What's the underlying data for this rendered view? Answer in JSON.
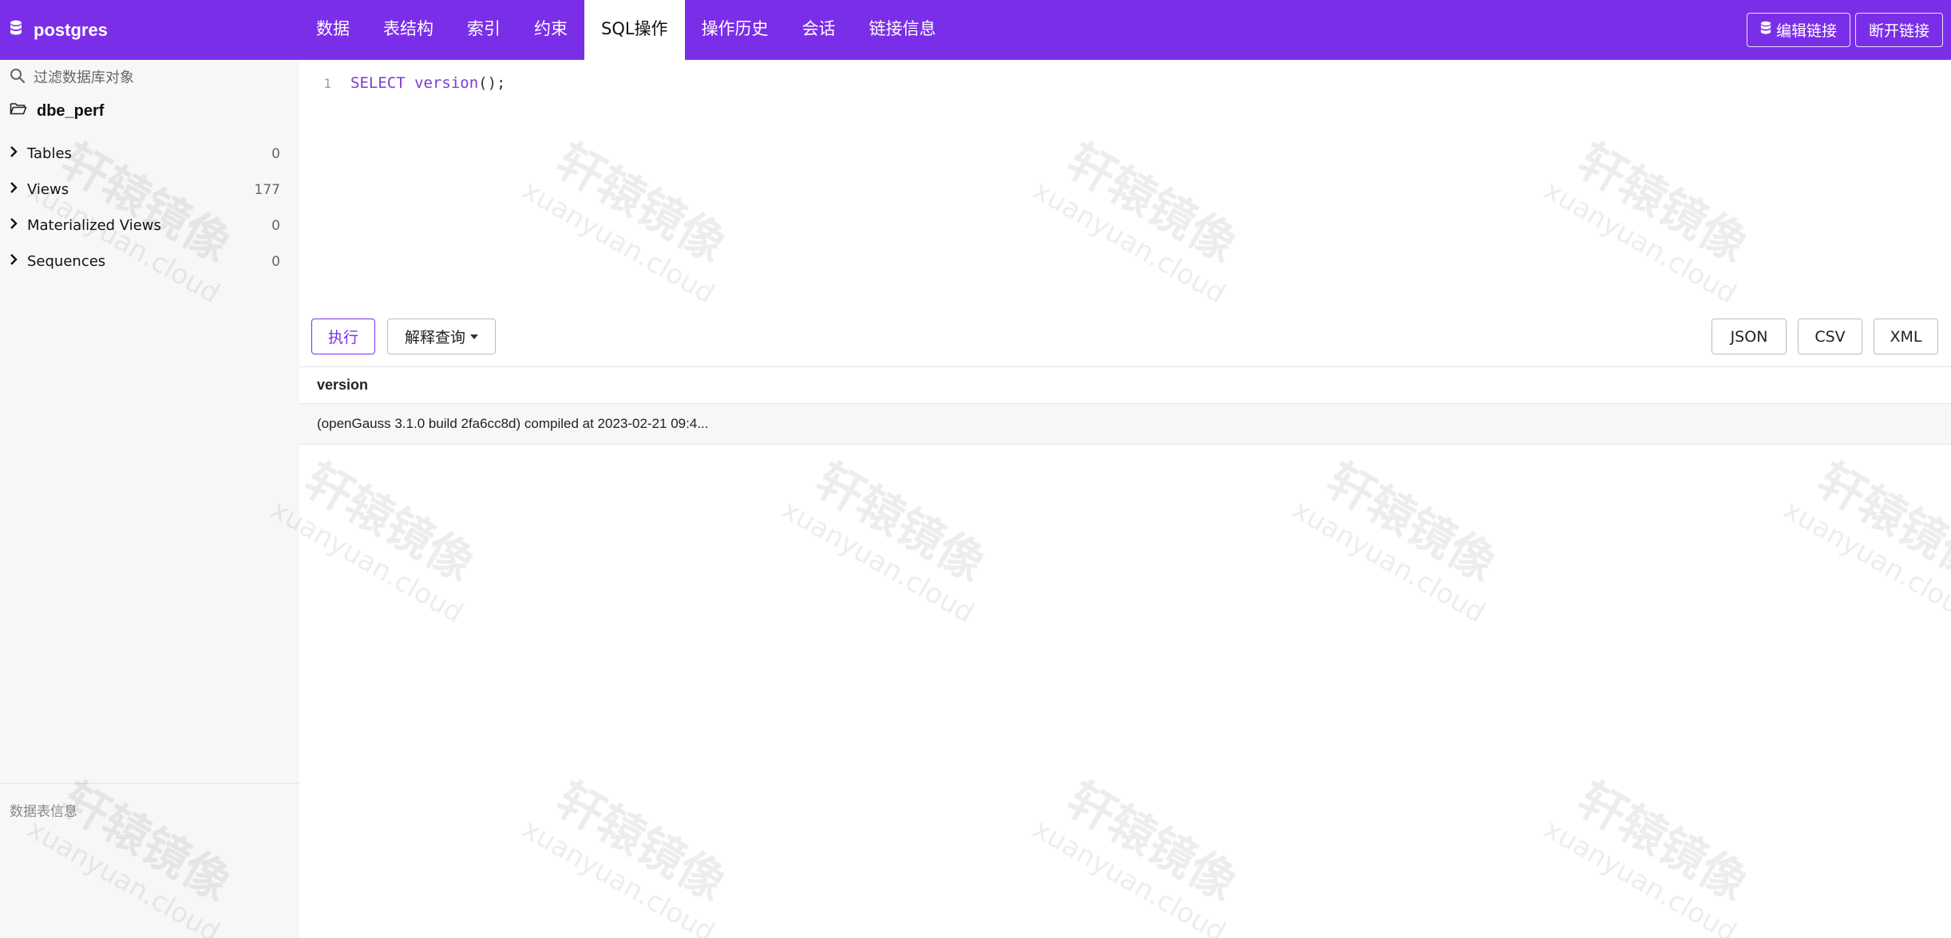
{
  "app": {
    "db_name": "postgres",
    "db_icon": "database-icon"
  },
  "tabs": [
    {
      "label": "数据"
    },
    {
      "label": "表结构"
    },
    {
      "label": "索引"
    },
    {
      "label": "约束"
    },
    {
      "label": "SQL操作",
      "active": true
    },
    {
      "label": "操作历史"
    },
    {
      "label": "会话"
    },
    {
      "label": "链接信息"
    }
  ],
  "top_actions": {
    "edit_connection": "编辑链接",
    "disconnect": "断开链接"
  },
  "sidebar": {
    "filter_placeholder": "过滤数据库对象",
    "schema": "dbe_perf",
    "items": [
      {
        "label": "Tables",
        "count": "0"
      },
      {
        "label": "Views",
        "count": "177"
      },
      {
        "label": "Materialized Views",
        "count": "0"
      },
      {
        "label": "Sequences",
        "count": "0"
      }
    ],
    "footer": "数据表信息"
  },
  "editor": {
    "line_number": "1",
    "keyword": "SELECT",
    "function": "version",
    "punct": "();"
  },
  "actions": {
    "run": "执行",
    "explain": "解释查询",
    "json": "JSON",
    "csv": "CSV",
    "xml": "XML"
  },
  "results": {
    "columns": [
      "version"
    ],
    "rows": [
      [
        "(openGauss 3.1.0 build 2fa6cc8d) compiled at 2023-02-21 09:4..."
      ]
    ]
  },
  "watermark": {
    "cn": "轩辕镜像",
    "en": "xuanyuan.cloud"
  },
  "colors": {
    "accent": "#7b2ee8"
  }
}
